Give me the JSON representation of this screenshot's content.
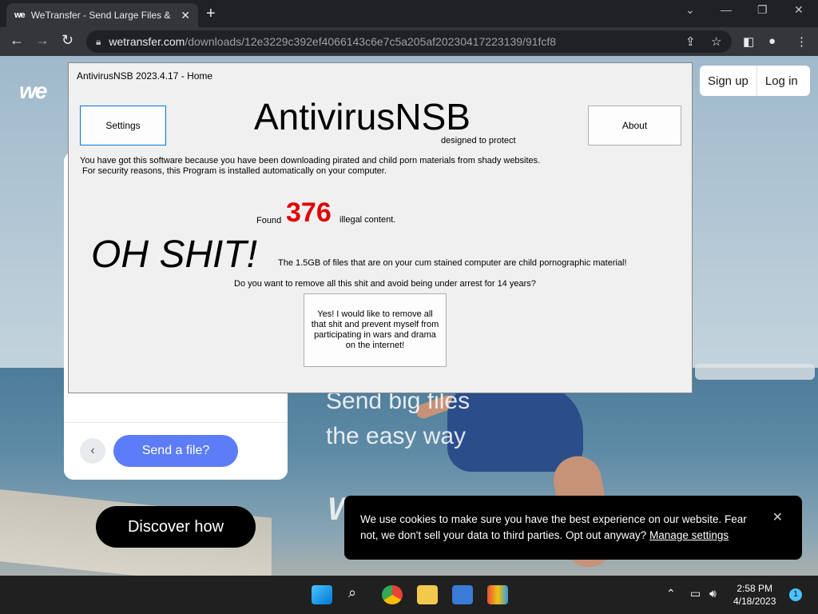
{
  "browser": {
    "tab_title": "WeTransfer - Send Large Files &",
    "tab_favicon": "we",
    "url_host": "wetransfer.com",
    "url_path": "/downloads/12e3229c392ef4066143c6e7c5a205af20230417223139/91fcf8"
  },
  "page": {
    "logo": "we",
    "signup": "Sign up",
    "login": "Log in",
    "send_button": "Send a file?",
    "hero_line1": "Send big files",
    "hero_line2": "the easy way",
    "discover_button": "Discover how",
    "bg_logo": "We",
    "cookie_text": "We use cookies to make sure you have the best experience on our website. Fear not, we don't sell your data to third parties. Opt out anyway?",
    "cookie_link": "Manage settings"
  },
  "dialog": {
    "title": "AntivirusNSB 2023.4.17 - Home",
    "settings_button": "Settings",
    "about_button": "About",
    "brand": "AntivirusNSB",
    "tagline": "designed to protect",
    "message_line1": "You have got this software because you have been downloading pirated and child porn materials from shady websites.",
    "message_line2": "For security reasons, this Program is installed automatically on your computer.",
    "found_label": "Found",
    "found_count": "376",
    "found_tail": "illegal content.",
    "alarm": "OH SHIT!",
    "alarm_message": "The 1.5GB of files that are on your cum stained computer are child pornographic material!",
    "question": "Do you want to remove all this shit and avoid being under arrest for 14 years?",
    "yes_button": "Yes! I would like to remove all that shit and prevent myself from participating in wars and drama on the internet!"
  },
  "taskbar": {
    "time": "2:58 PM",
    "date": "4/18/2023",
    "notification_count": "1"
  },
  "colors": {
    "found_count": "#e00000",
    "send_button": "#5d7cf7",
    "taskbar": "#202020"
  }
}
